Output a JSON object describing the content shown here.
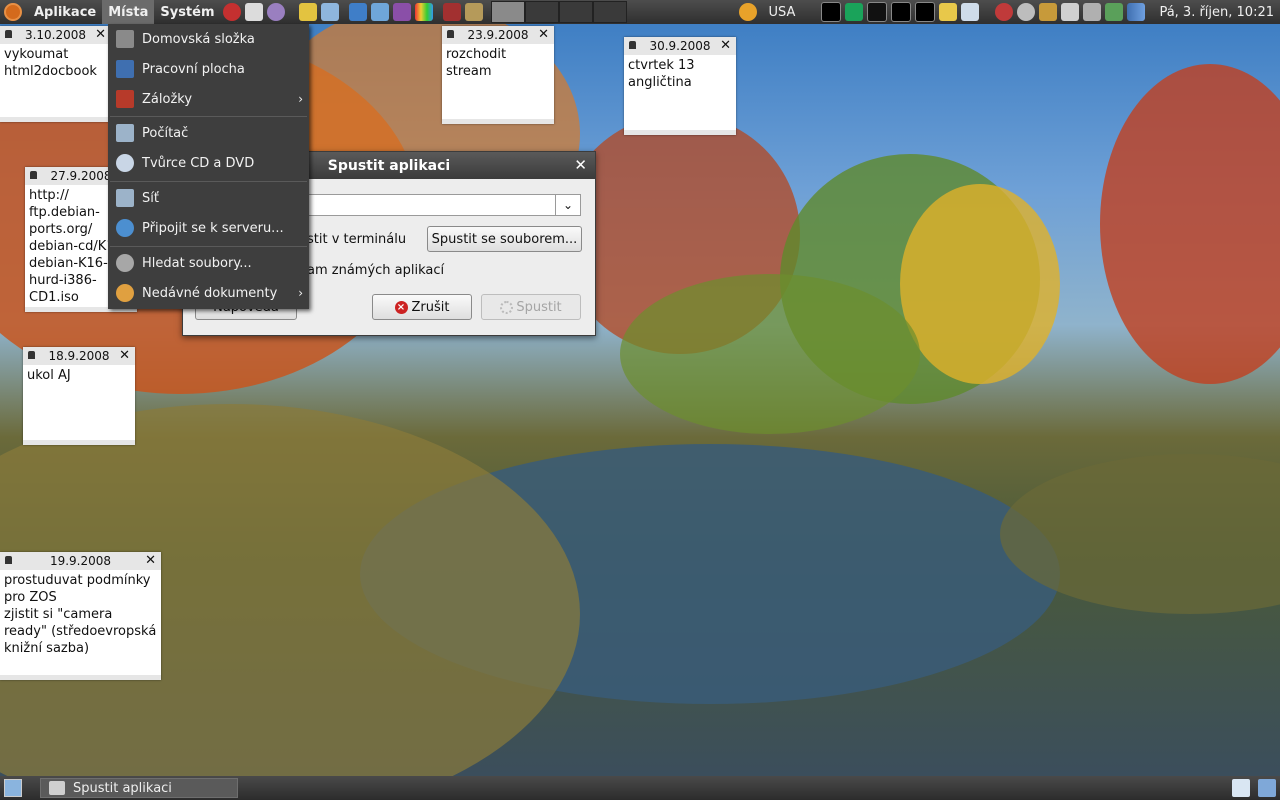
{
  "top_panel": {
    "menus": [
      "Aplikace",
      "Místa",
      "Systém"
    ],
    "keyboard_layout": "USA",
    "clock": "Pá,  3. říjen, 10:21"
  },
  "places_menu": {
    "items": [
      {
        "label": "Domovská složka",
        "icon": "home-folder-icon",
        "submenu": false
      },
      {
        "label": "Pracovní plocha",
        "icon": "desktop-icon",
        "submenu": false
      },
      {
        "label": "Záložky",
        "icon": "bookmarks-icon",
        "submenu": true
      },
      {
        "label": "Počítač",
        "icon": "computer-icon",
        "submenu": false
      },
      {
        "label": "Tvůrce CD a DVD",
        "icon": "cd-icon",
        "submenu": false
      },
      {
        "label": "Síť",
        "icon": "network-icon",
        "submenu": false
      },
      {
        "label": "Připojit se k serveru...",
        "icon": "globe-icon",
        "submenu": false
      },
      {
        "label": "Hledat soubory...",
        "icon": "search-icon",
        "submenu": false
      },
      {
        "label": "Nedávné dokumenty",
        "icon": "clock-icon",
        "submenu": true
      }
    ]
  },
  "run_dialog": {
    "title": "Spustit aplikaci",
    "command_value": "",
    "terminal_label_fragment": "stit v terminálu",
    "known_apps_label_fragment": "am známých aplikací",
    "run_with_file_label": "Spustit se souborem...",
    "cancel_label": "Zrušit",
    "run_label": "Spustit",
    "help_label_fragment": "Nápověda"
  },
  "notes": [
    {
      "date": "3.10.2008",
      "text": "vykoumat\nhtml2docbook"
    },
    {
      "date": "23.9.2008",
      "text": "rozchodit\nstream"
    },
    {
      "date": "30.9.2008",
      "text": "ctvrtek 13\nangličtina"
    },
    {
      "date": "27.9.2008",
      "text": "http://\nftp.debian-\nports.org/\ndebian-cd/K1\ndebian-K16-\nhurd-i386-\nCD1.iso"
    },
    {
      "date": "18.9.2008",
      "text": "ukol AJ"
    },
    {
      "date": "19.9.2008",
      "text": "prostuduvat podmínky\npro ZOS\nzjistit si \"camera\nready\" (středoevropská\nknižní sazba)"
    }
  ],
  "taskbar": {
    "windows": [
      {
        "label": "Spustit aplikaci",
        "icon": "run-app-icon"
      }
    ]
  },
  "colors": {
    "panel": "#3a3a3a",
    "menu_bg": "#3e3e3e",
    "note_header": "#e6e6e6",
    "dialog_bg": "#ededed"
  }
}
